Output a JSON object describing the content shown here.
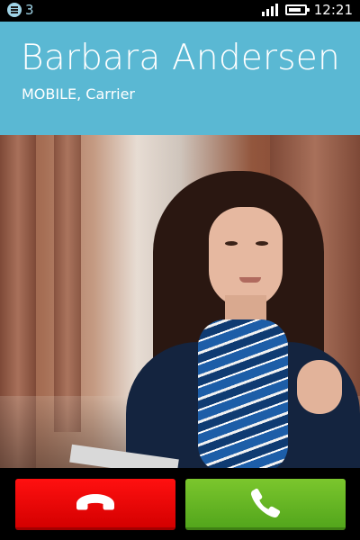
{
  "status_bar": {
    "notification_icon": "notification-list-icon",
    "notification_count": "3",
    "signal_icon": "signal-strength-icon",
    "signal_level": 1.0,
    "battery_icon": "battery-icon",
    "battery_level": 0.8,
    "time": "12:21"
  },
  "caller": {
    "name": "Barbara Andersen",
    "subtitle": "MOBILE, Carrier"
  },
  "actions": {
    "hangup_icon": "phone-hangup-icon",
    "answer_icon": "phone-answer-icon"
  },
  "colors": {
    "header_bg": "#5ab8d3",
    "hangup_bg": "#e60000",
    "answer_bg": "#6bb626"
  }
}
